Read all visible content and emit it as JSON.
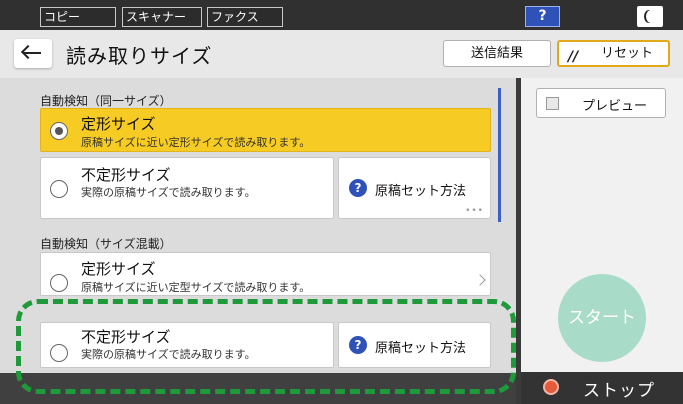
{
  "topbar": {
    "tabs": [
      "コピー",
      "スキャナー",
      "ファクス"
    ],
    "help_label": "?"
  },
  "header": {
    "title": "読み取りサイズ",
    "result_label": "送信結果",
    "reset_label": "リセット"
  },
  "sections": [
    {
      "label": "自動検知（同一サイズ）",
      "options": [
        {
          "title": "定形サイズ",
          "desc": "原稿サイズに近い定形サイズで読み取ります。",
          "selected": true
        },
        {
          "title": "不定形サイズ",
          "desc": "実際の原稿サイズで読み取ります。",
          "selected": false
        }
      ],
      "guide_label": "原稿セット方法"
    },
    {
      "label": "自動検知（サイズ混載）",
      "options": [
        {
          "title": "定形サイズ",
          "desc": "原稿サイズに近い定型サイズで読み取ります。",
          "selected": false
        },
        {
          "title": "不定形サイズ",
          "desc": "実際の原稿サイズで読み取ります。",
          "selected": false
        }
      ],
      "guide_label": "原稿セット方法"
    }
  ],
  "right_panel": {
    "preview_label": "プレビュー",
    "start_label": "スタート",
    "stop_label": "ストップ"
  },
  "colors": {
    "selected_bg": "#f6cb24",
    "accent_blue": "#2f52b8",
    "highlight_dash": "#1f9a3a",
    "reset_border": "#e0a91a",
    "start_bg": "#a8dcc8",
    "stop_icon": "#e55a3c"
  }
}
